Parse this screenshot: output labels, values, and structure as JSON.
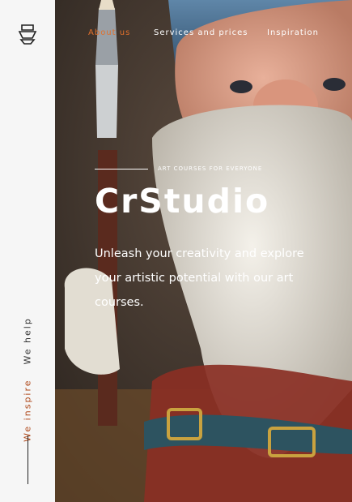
{
  "brand": {
    "logo_icon": "easel-hat-icon"
  },
  "nav": {
    "items": [
      {
        "label": "About us",
        "active": true
      },
      {
        "label": "Services and prices",
        "active": false
      },
      {
        "label": "Inspiration",
        "active": false
      }
    ]
  },
  "sidebar": {
    "inspire": "We inspire",
    "help": "We help"
  },
  "hero": {
    "eyebrow": "ART COURSES FOR EVERYONE",
    "title": "CrStudio",
    "description": "Unleash your creativity and explore your artistic potential with our art courses.",
    "image_icon": "gnome-painter-illustration"
  },
  "colors": {
    "accent": "#e0702c",
    "sidebar_bg": "#f6f6f6",
    "text_light": "#ffffff"
  }
}
